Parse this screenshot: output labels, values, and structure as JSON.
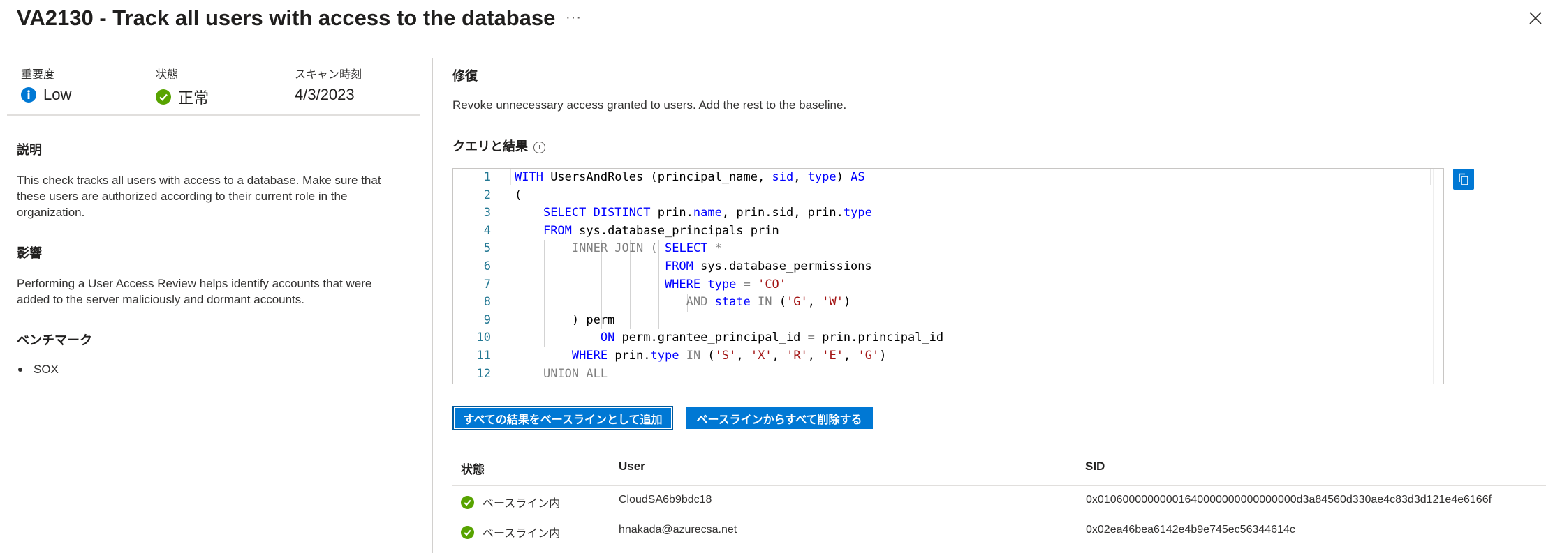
{
  "header": {
    "title": "VA2130 - Track all users with access to the database",
    "more_label": "···"
  },
  "summary": {
    "severity_label": "重要度",
    "severity_value": "Low",
    "status_label": "状態",
    "status_value": "正常",
    "scan_label": "スキャン時刻",
    "scan_value": "4/3/2023"
  },
  "description": {
    "heading": "説明",
    "text": "This check tracks all users with access to a database. Make sure that these users are authorized according to their current role in the organization."
  },
  "impact": {
    "heading": "影響",
    "text": "Performing a User Access Review helps identify accounts that were added to the server maliciously and dormant accounts."
  },
  "benchmark": {
    "heading": "ベンチマーク",
    "items": [
      "SOX"
    ]
  },
  "remediation": {
    "heading": "修復",
    "text": "Revoke unnecessary access granted to users. Add the rest to the baseline."
  },
  "query": {
    "heading": "クエリと結果",
    "info_icon": "i",
    "line_numbers": [
      "1",
      "2",
      "3",
      "4",
      "5",
      "6",
      "7",
      "8",
      "9",
      "10",
      "11",
      "12"
    ]
  },
  "buttons": {
    "add_baseline": "すべての結果をベースラインとして追加",
    "remove_baseline": "ベースラインからすべて削除する"
  },
  "results": {
    "columns": [
      "状態",
      "User",
      "SID"
    ],
    "rows": [
      {
        "status": "ベースライン内",
        "user": "CloudSA6b9bdc18",
        "sid": "0x01060000000001640000000000000000d3a84560d330ae4c83d3d121e4e6166f"
      },
      {
        "status": "ベースライン内",
        "user": "hnakada@azurecsa.net",
        "sid": "0x02ea46bea6142e4b9e745ec56344614c"
      }
    ]
  },
  "colors": {
    "accent": "#0078d4",
    "success": "#57a300",
    "info": "#0078d4"
  },
  "icons": {
    "close": "close-icon",
    "copy": "copy-icon",
    "severity": "info-circle-icon",
    "status": "check-circle-icon"
  }
}
